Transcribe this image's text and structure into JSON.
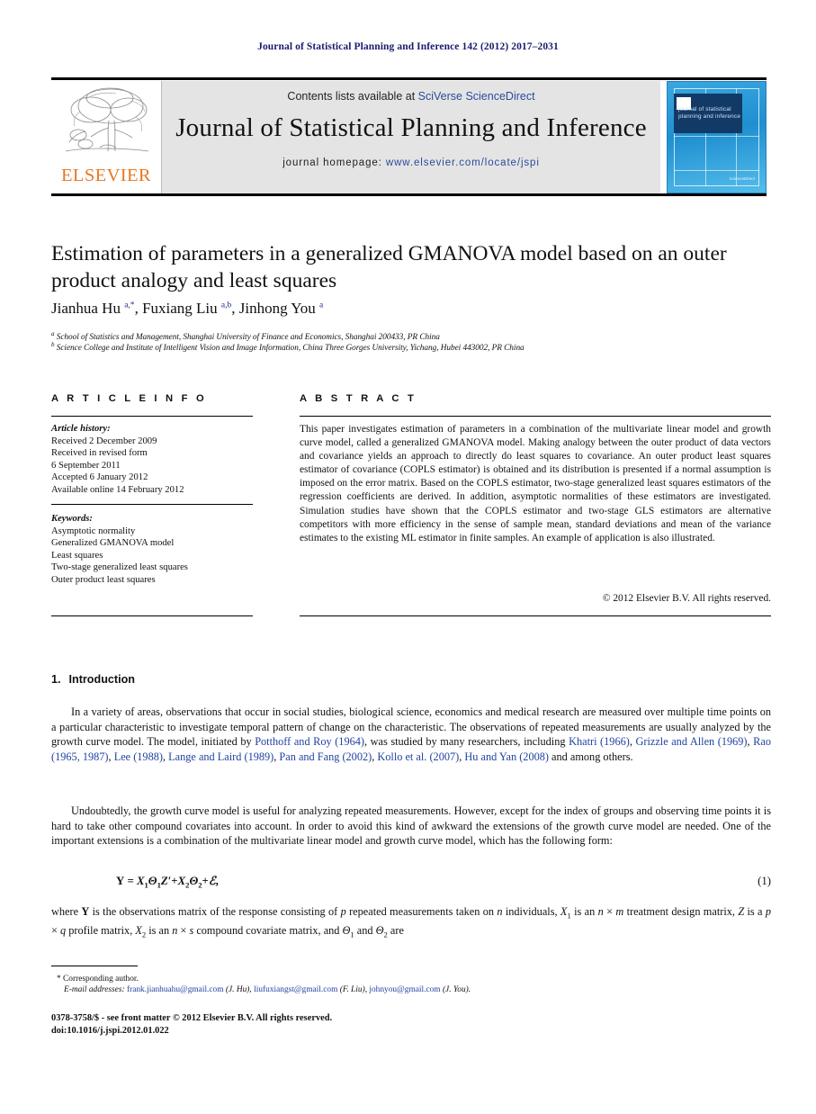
{
  "running_head": "Journal of Statistical Planning and Inference 142 (2012) 2017–2031",
  "masthead": {
    "contents_prefix": "Contents lists available at ",
    "contents_link": "SciVerse ScienceDirect",
    "journal_name": "Journal of Statistical Planning and Inference",
    "homepage_prefix": "journal homepage: ",
    "homepage_url": "www.elsevier.com/locate/jspi",
    "publisher": "ELSEVIER",
    "cover_title": "journal of statistical planning and inference",
    "cover_footer": "ScienceDirect"
  },
  "article": {
    "title": "Estimation of parameters in a generalized GMANOVA model based on an outer product analogy and least squares",
    "authors_html": "Jianhua Hu <sup>a,*</sup>, Fuxiang Liu <sup>a,b</sup>, Jinhong You <sup>a</sup>",
    "affiliation_a": "School of Statistics and Management, Shanghai University of Finance and Economics, Shanghai 200433, PR China",
    "affiliation_b": "Science College and Institute of Intelligent Vision and Image Information, China Three Gorges University, Yichang, Hubei 443002, PR China"
  },
  "info": {
    "heading": "A R T I C L E    I N F O",
    "history_label": "Article history:",
    "history": [
      "Received 2 December 2009",
      "Received in revised form",
      "6 September 2011",
      "Accepted 6 January 2012",
      "Available online 14 February 2012"
    ],
    "keywords_label": "Keywords:",
    "keywords": [
      "Asymptotic normality",
      "Generalized GMANOVA model",
      "Least squares",
      "Two-stage generalized least squares",
      "Outer product least squares"
    ]
  },
  "abstract": {
    "heading": "A B S T R A C T",
    "text": "This paper investigates estimation of parameters in a combination of the multivariate linear model and growth curve model, called a generalized GMANOVA model. Making analogy between the outer product of data vectors and covariance yields an approach to directly do least squares to covariance. An outer product least squares estimator of covariance (COPLS estimator) is obtained and its distribution is presented if a normal assumption is imposed on the error matrix. Based on the COPLS estimator, two-stage generalized least squares estimators of the regression coefficients are derived. In addition, asymptotic normalities of these estimators are investigated. Simulation studies have shown that the COPLS estimator and two-stage GLS estimators are alternative competitors with more efficiency in the sense of sample mean, standard deviations and mean of the variance estimates to the existing ML estimator in finite samples. An example of application is also illustrated.",
    "copyright": "© 2012 Elsevier B.V. All rights reserved."
  },
  "body": {
    "section_number": "1.",
    "section_title": "Introduction",
    "para1_html": "In a variety of areas, observations that occur in social studies, biological science, economics and medical research are measured over multiple time points on a particular characteristic to investigate temporal pattern of change on the characteristic. The observations of repeated measurements are usually analyzed by the growth curve model. The model, initiated by <span class=\"cite\">Potthoff and Roy (1964)</span>, was studied by many researchers, including <span class=\"cite\">Khatri (1966)</span>, <span class=\"cite\">Grizzle and Allen (1969)</span>, <span class=\"cite\">Rao (1965, 1987)</span>, <span class=\"cite\">Lee (1988)</span>, <span class=\"cite\">Lange and Laird (1989)</span>, <span class=\"cite\">Pan and Fang (2002)</span>, <span class=\"cite\">Kollo et al. (2007)</span>, <span class=\"cite\">Hu and Yan (2008)</span> and among others.",
    "para2_html": "Undoubtedly, the growth curve model is useful for analyzing repeated measurements. However, except for the index of groups and observing time points it is hard to take other compound covariates into account. In order to avoid this kind of awkward the extensions of the growth curve model are needed. One of the important extensions is a combination of the multivariate linear model and growth curve model, which has the following form:",
    "equation_html": "<b>Y</b> = <i>X</i><sub class=\"sm\">1</sub><i>&Theta;</i><sub class=\"sm\">1</sub><i>Z</i>&prime;+<i>X</i><sub class=\"sm\">2</sub><i>&Theta;</i><sub class=\"sm\">2</sub>+<i>&#8496;</i>,",
    "equation_number": "(1)",
    "para3_html": "where <b>Y</b> is the observations matrix of the response consisting of <i>p</i> repeated measurements taken on <i>n</i> individuals, <i>X</i><sub class=\"sm\">1</sub> is an <i>n</i> × <i>m</i> treatment design matrix, <i>Z</i> is a <i>p</i> × <i>q</i> profile matrix, <i>X</i><sub class=\"sm\">2</sub> is an <i>n</i> × <i>s</i> compound covariate matrix, and <i>&Theta;</i><sub class=\"sm\">1</sub> and <i>&Theta;</i><sub class=\"sm\">2</sub> are"
  },
  "footnotes": {
    "corresponding": "Corresponding author.",
    "email_label": "E-mail addresses:",
    "emails_html": "<span class=\"addr\">frank.jianhuahu@gmail.com</span> (J. Hu), <span class=\"addr\">liufuxiangst@gmail.com</span> (F. Liu), <span class=\"addr\">johnyou@gmail.com</span> (J. You).",
    "imprint_line1": "0378-3758/$ - see front matter © 2012 Elsevier B.V. All rights reserved.",
    "imprint_line2": "doi:10.1016/j.jspi.2012.01.022"
  },
  "colors": {
    "runhead": "#1a1a6e",
    "link": "#2a4b9b",
    "cite": "#2143a0",
    "elsevier_orange": "#E87722",
    "band_grey": "#e4e4e4",
    "cover_blue": "#1f8fd0"
  }
}
